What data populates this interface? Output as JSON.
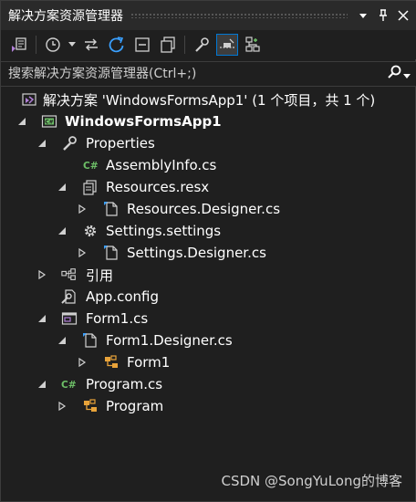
{
  "window": {
    "title": "解决方案资源管理器",
    "buttons": [
      "dropdown-icon",
      "pin-icon",
      "close-icon"
    ]
  },
  "toolbar": {
    "tools": [
      "vs-switch-views-icon",
      "history-icon",
      "sync-icon",
      "refresh-icon",
      "collapse-all-icon",
      "show-all-files-icon",
      "properties-icon",
      "preview-selected-icon",
      "class-diagram-icon"
    ]
  },
  "search": {
    "placeholder": "搜索解决方案资源管理器(Ctrl+;)"
  },
  "tree": {
    "solution": "解决方案 'WindowsFormsApp1' (1 个项目，共 1 个)",
    "project": "WindowsFormsApp1",
    "properties": "Properties",
    "assemblyinfo": "AssemblyInfo.cs",
    "resources_resx": "Resources.resx",
    "resources_designer": "Resources.Designer.cs",
    "settings_settings": "Settings.settings",
    "settings_designer": "Settings.Designer.cs",
    "references": "引用",
    "app_config": "App.config",
    "form1": "Form1.cs",
    "form1_designer": "Form1.Designer.cs",
    "form1_class": "Form1",
    "program_cs": "Program.cs",
    "program_class": "Program"
  },
  "footer": {
    "watermark": "CSDN @SongYuLong的博客"
  },
  "colors": {
    "background": "#1f1f1f",
    "accent": "#0078d4",
    "csharp_green": "#6dbf67",
    "vs_purple": "#b180d7"
  }
}
